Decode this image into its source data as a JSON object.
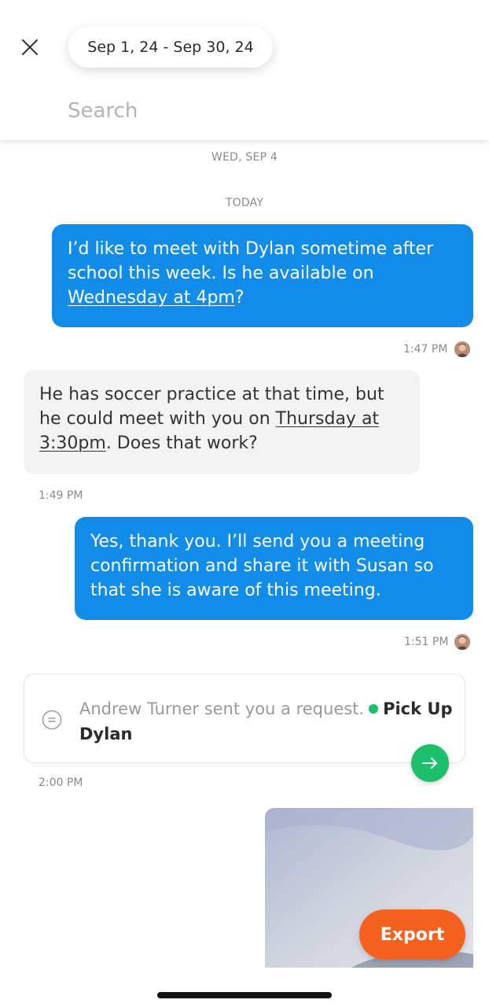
{
  "header": {
    "date_range": "Sep 1, 24 - Sep 30, 24",
    "search_placeholder": "Search"
  },
  "separators": {
    "first": "WED, SEP 4",
    "second": "TODAY"
  },
  "messages": [
    {
      "direction": "outgoing",
      "text_before": "I’d like to meet with Dylan sometime after school this week. Is he available on ",
      "link": "Wednesday at 4pm",
      "text_after": "?",
      "time": "1:47 PM"
    },
    {
      "direction": "incoming",
      "text_before": "He has soccer practice at that time, but he could meet with you on ",
      "link": "Thursday at 3:30pm",
      "text_after": ". Does that work?",
      "time": "1:49 PM"
    },
    {
      "direction": "outgoing",
      "text": "Yes, thank you. I’ll send you a meeting confirmation and share it with Susan so that she is aware of this meeting.",
      "time": "1:51 PM"
    }
  ],
  "request": {
    "prefix": "Andrew Turner sent you a request.",
    "title": "Pick Up Dylan",
    "status_color": "#1bbf6a",
    "time": "2:00 PM"
  },
  "export_label": "Export",
  "colors": {
    "outgoing_bubble": "#118ce8",
    "incoming_bubble": "#f3f3f3",
    "action_green": "#1cc06b",
    "export_orange": "#f5621f"
  }
}
